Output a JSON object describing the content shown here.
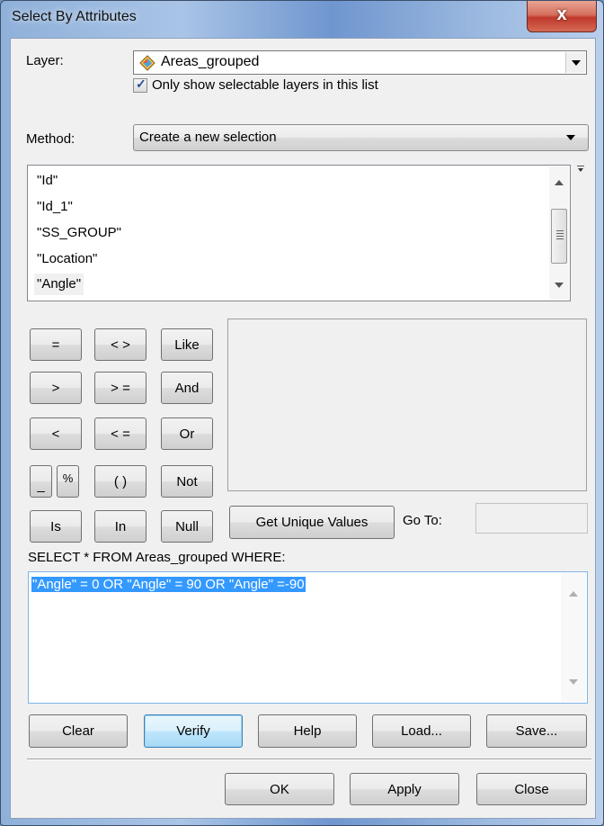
{
  "window": {
    "title": "Select By Attributes",
    "close_label": "x"
  },
  "layer": {
    "label": "Layer:",
    "selected": "Areas_grouped",
    "icon": "polygon-layer-icon",
    "checkbox_label": "Only show selectable layers in this list",
    "checkbox_checked": true
  },
  "method": {
    "label": "Method:",
    "selected": "Create a new selection"
  },
  "fields": {
    "items": [
      "\"Id\"",
      "\"Id_1\"",
      "\"SS_GROUP\"",
      "\"Location\"",
      "\"Angle\""
    ],
    "selected_index": 4
  },
  "operators": {
    "eq": "=",
    "neq": "< >",
    "like": "Like",
    "gt": ">",
    "gte": "> =",
    "and": "And",
    "lt": "<",
    "lte": "< =",
    "or": "Or",
    "underscore": "_",
    "percent": "%",
    "parens": "( )",
    "not": "Not",
    "is": "Is",
    "in": "In",
    "null": "Null"
  },
  "unique": {
    "button": "Get Unique Values",
    "goto_label": "Go To:",
    "goto_value": ""
  },
  "query": {
    "header": "SELECT * FROM Areas_grouped WHERE:",
    "expression": "\"Angle\" = 0 OR \"Angle\" = 90 OR \"Angle\" =-90"
  },
  "actions": {
    "clear": "Clear",
    "verify": "Verify",
    "help": "Help",
    "load": "Load...",
    "save": "Save..."
  },
  "footer": {
    "ok": "OK",
    "apply": "Apply",
    "close": "Close"
  }
}
